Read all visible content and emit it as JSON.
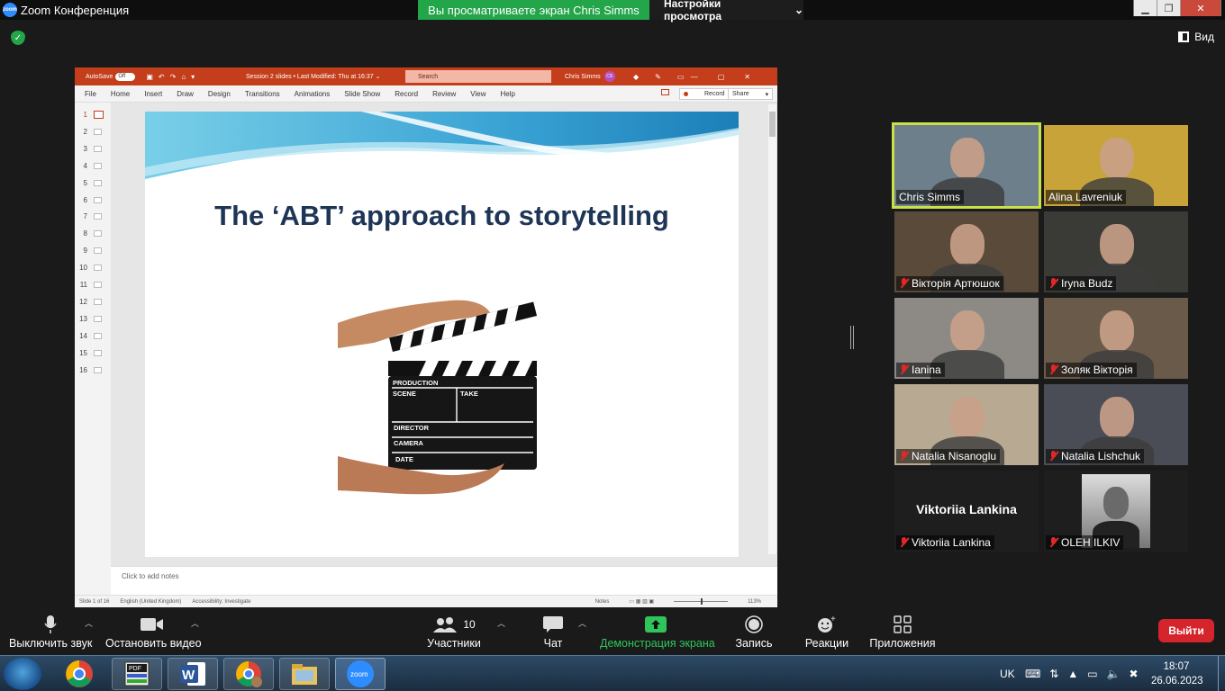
{
  "window": {
    "title": "Zoom Конференция",
    "share_banner": "Вы просматриваете экран Chris Simms",
    "view_options": "Настройки просмотра",
    "view_button": "Вид"
  },
  "shared": {
    "ppt": {
      "autosave": "AutoSave",
      "autosave_state": "Off",
      "doc_title": "Session 2 slides • Last Modified: Thu at 16:37 ⌄",
      "search_placeholder": "Search",
      "user_name": "Chris Simms",
      "user_initials": "CS",
      "menu": [
        "File",
        "Home",
        "Insert",
        "Draw",
        "Design",
        "Transitions",
        "Animations",
        "Slide Show",
        "Record",
        "Review",
        "View",
        "Help"
      ],
      "record_btn": "Record",
      "share_btn": "Share",
      "slide_numbers": [
        "1",
        "2",
        "3",
        "4",
        "5",
        "6",
        "7",
        "8",
        "9",
        "10",
        "11",
        "12",
        "13",
        "14",
        "15",
        "16"
      ],
      "slide_title": "The ‘ABT’ approach to storytelling",
      "clapper": {
        "production": "PRODUCTION",
        "scene": "SCENE",
        "take": "TAKE",
        "director": "DIRECTOR",
        "camera": "CAMERA",
        "date": "DATE"
      },
      "notes_placeholder": "Click to add notes",
      "status": {
        "slide_of": "Slide 1 of 16",
        "language": "English (United Kingdom)",
        "accessibility": "Accessibility: Investigate",
        "notes": "Notes",
        "zoom": "113%"
      }
    }
  },
  "participants": [
    {
      "name": "Chris Simms",
      "muted": false,
      "speaking": true,
      "bg": "#6d7f8a"
    },
    {
      "name": "Alina Lavreniuk",
      "muted": false,
      "speaking": false,
      "bg": "#c8a33a"
    },
    {
      "name": "Вікторія Артюшок",
      "muted": true,
      "speaking": false,
      "bg": "#5a4a3a"
    },
    {
      "name": "Iryna Budz",
      "muted": true,
      "speaking": false,
      "bg": "#3a3a36"
    },
    {
      "name": "Ianina",
      "muted": true,
      "speaking": false,
      "bg": "#8d8a85"
    },
    {
      "name": "Золяк Вікторія",
      "muted": true,
      "speaking": false,
      "bg": "#6a5a4a"
    },
    {
      "name": "Natalia Nisanoglu",
      "muted": true,
      "speaking": false,
      "bg": "#b8aa92"
    },
    {
      "name": "Natalia Lishchuk",
      "muted": true,
      "speaking": false,
      "bg": "#4a4d55"
    },
    {
      "name": "Viktoriia Lankina",
      "muted": true,
      "speaking": false,
      "bg": "#1e1e1e",
      "display_name": "Viktoriia Lankina"
    },
    {
      "name": "OLEH  ILKIV",
      "muted": true,
      "speaking": false,
      "bg": "#1e1e1e"
    }
  ],
  "toolbar": {
    "mute": "Выключить звук",
    "video": "Остановить видео",
    "participants": "Участники",
    "participants_count": "10",
    "chat": "Чат",
    "share": "Демонстрация экрана",
    "record": "Запись",
    "reactions": "Реакции",
    "apps": "Приложения",
    "leave": "Выйти"
  },
  "taskbar": {
    "lang": "UK",
    "time": "18:07",
    "date": "26.06.2023",
    "apps": [
      "chrome-icon",
      "pdf-icon",
      "word-icon",
      "chrome-profile-icon",
      "explorer-icon",
      "zoom-icon"
    ]
  },
  "colors": {
    "share_green": "#23a549",
    "ppt_red": "#c43e1c",
    "speaker_outline": "#c8e04a",
    "leave_red": "#d6242d"
  }
}
